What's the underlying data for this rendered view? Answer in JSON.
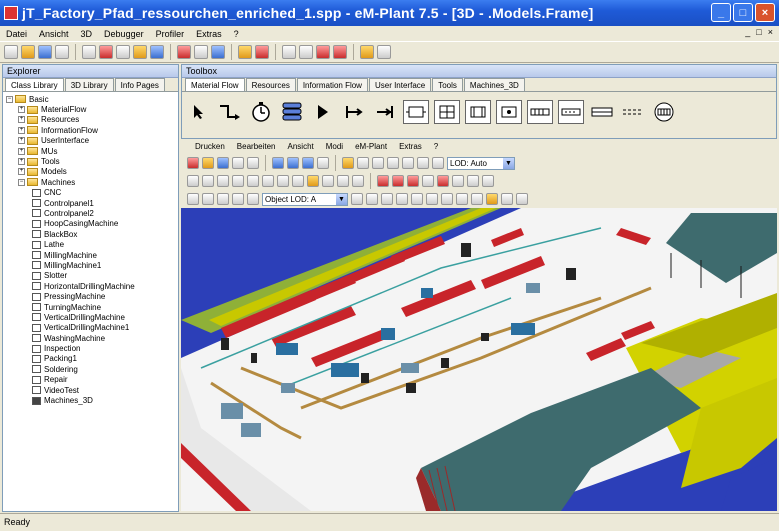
{
  "window": {
    "title": "jT_Factory_Pfad_ressourchen_enriched_1.spp - eM-Plant 7.5 - [3D - .Models.Frame]",
    "min_glyph": "_",
    "max_glyph": "□",
    "close_glyph": "×"
  },
  "menu": [
    "Datei",
    "Ansicht",
    "3D",
    "Debugger",
    "Profiler",
    "Extras",
    "?"
  ],
  "mdi_controls": [
    "_",
    "□",
    "×"
  ],
  "explorer": {
    "header": "Explorer",
    "tabs": [
      "Class Library",
      "3D Library",
      "Info Pages"
    ],
    "tree": [
      {
        "label": "Basic",
        "level": 0,
        "kind": "folder",
        "expander": "−"
      },
      {
        "label": "MaterialFlow",
        "level": 1,
        "kind": "folder",
        "expander": "+"
      },
      {
        "label": "Resources",
        "level": 1,
        "kind": "folder",
        "expander": "+"
      },
      {
        "label": "InformationFlow",
        "level": 1,
        "kind": "folder",
        "expander": "+"
      },
      {
        "label": "UserInterface",
        "level": 1,
        "kind": "folder",
        "expander": "+"
      },
      {
        "label": "MUs",
        "level": 1,
        "kind": "folder",
        "expander": "+"
      },
      {
        "label": "Tools",
        "level": 1,
        "kind": "folder",
        "expander": "+"
      },
      {
        "label": "Models",
        "level": 1,
        "kind": "folder",
        "expander": "+"
      },
      {
        "label": "Machines",
        "level": 1,
        "kind": "folder",
        "expander": "−"
      },
      {
        "label": "CNC",
        "level": 2,
        "kind": "class"
      },
      {
        "label": "Controlpanel1",
        "level": 2,
        "kind": "class"
      },
      {
        "label": "Controlpanel2",
        "level": 2,
        "kind": "class"
      },
      {
        "label": "HoopCasingMachine",
        "level": 2,
        "kind": "class"
      },
      {
        "label": "BlackBox",
        "level": 2,
        "kind": "class"
      },
      {
        "label": "Lathe",
        "level": 2,
        "kind": "class"
      },
      {
        "label": "MillingMachine",
        "level": 2,
        "kind": "class"
      },
      {
        "label": "MillingMachine1",
        "level": 2,
        "kind": "class"
      },
      {
        "label": "Slotter",
        "level": 2,
        "kind": "class"
      },
      {
        "label": "HorizontalDrillingMachine",
        "level": 2,
        "kind": "class"
      },
      {
        "label": "PressingMachine",
        "level": 2,
        "kind": "class"
      },
      {
        "label": "TurningMachine",
        "level": 2,
        "kind": "class"
      },
      {
        "label": "VerticalDrillingMachine",
        "level": 2,
        "kind": "class"
      },
      {
        "label": "VerticalDrillingMachine1",
        "level": 2,
        "kind": "class"
      },
      {
        "label": "WashingMachine",
        "level": 2,
        "kind": "class"
      },
      {
        "label": "Inspection",
        "level": 2,
        "kind": "class"
      },
      {
        "label": "Packing1",
        "level": 2,
        "kind": "class"
      },
      {
        "label": "Soldering",
        "level": 2,
        "kind": "class"
      },
      {
        "label": "Repair",
        "level": 2,
        "kind": "class"
      },
      {
        "label": "VideoTest",
        "level": 2,
        "kind": "class"
      },
      {
        "label": "Machines_3D",
        "level": 2,
        "kind": "class-dark"
      }
    ]
  },
  "toolbox": {
    "header": "Toolbox",
    "tabs": [
      "Material Flow",
      "Resources",
      "Information Flow",
      "User Interface",
      "Tools",
      "Machines_3D"
    ],
    "icons": [
      "pointer-icon",
      "connector-icon",
      "event-controller-icon",
      "frame-icon",
      "interface-icon",
      "source-icon",
      "drain-icon",
      "single-proc-icon",
      "parallel-proc-icon",
      "assembly-icon",
      "dismantle-icon",
      "buffer-icon",
      "sorter-icon",
      "line-icon",
      "track-icon",
      "turntable-icon"
    ]
  },
  "frame_menu": [
    "Drucken",
    "Bearbeiten",
    "Ansicht",
    "Modi",
    "eM-Plant",
    "Extras",
    "?"
  ],
  "lod_select": {
    "value": "LOD: Auto",
    "shown": "LOD: Auto"
  },
  "object_lod_select": {
    "value": "Object LOD: A"
  },
  "status": {
    "text": "Ready"
  },
  "colors": {
    "title_bar": "#1f5bd8",
    "scene_background": "#2c3fb8",
    "floor": "#f4f4f4",
    "machine_red": "#c8242a",
    "hall_roof": "#3e6b6e",
    "wall_yellow": "#c8c800"
  }
}
